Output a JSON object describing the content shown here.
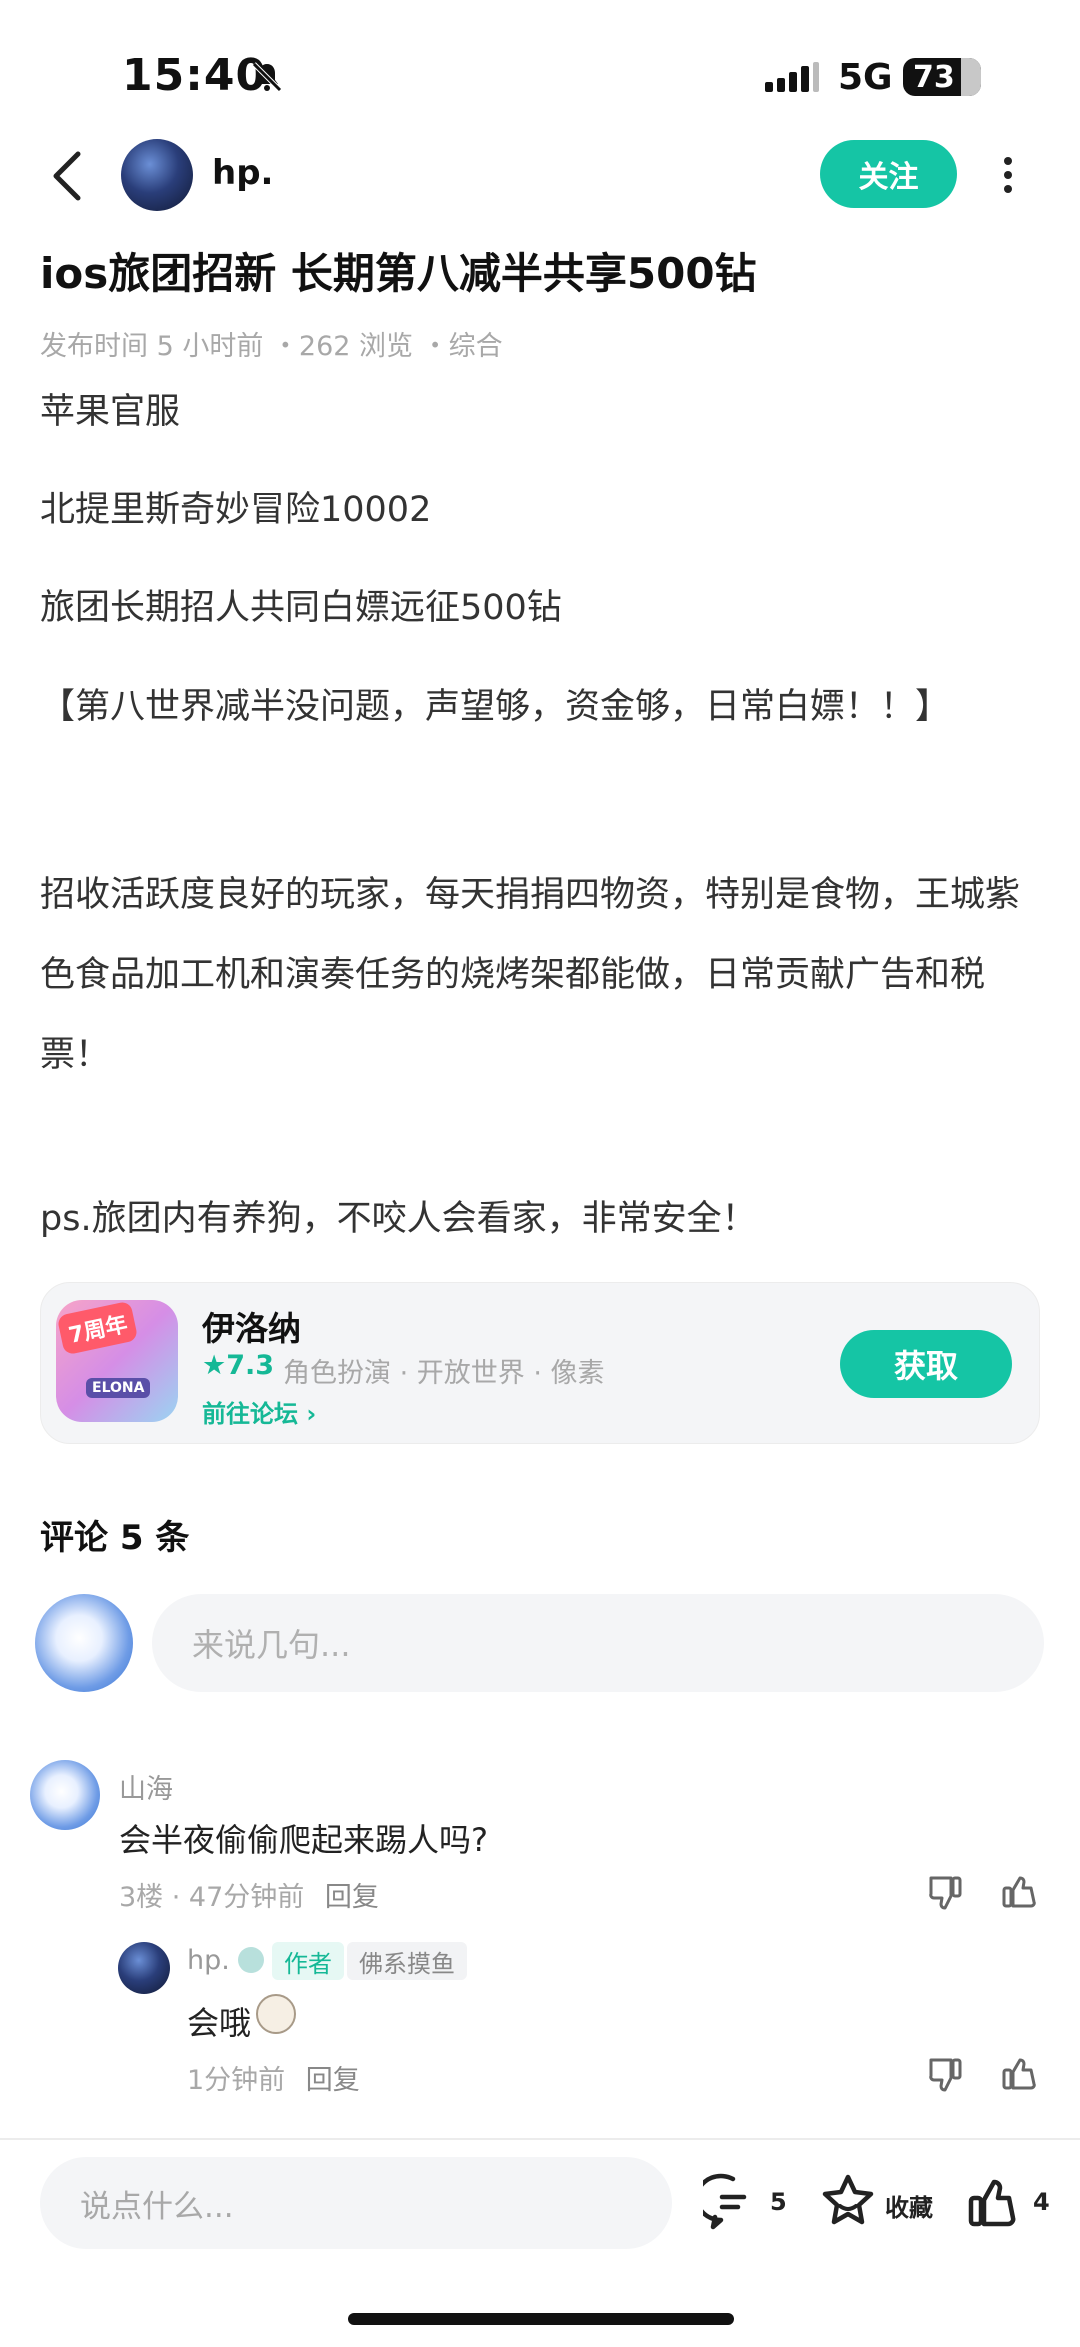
{
  "status_bar": {
    "time": "15:40",
    "network": "5G",
    "battery": "73"
  },
  "header": {
    "author": "hp.",
    "follow_label": "关注"
  },
  "post": {
    "title": "ios旅团招新 长期第八减半共享500钻",
    "meta": "发布时间 5 小时前 ・262 浏览 ・综合",
    "paragraphs": [
      "苹果官服",
      "北提里斯奇妙冒险10002",
      "旅团长期招人共同白嫖远征500钻",
      "【第八世界减半没问题，声望够，资金够，日常白嫖！！】",
      "招收活跃度良好的玩家，每天捐捐四物资，特别是食物，王城紫色食品加工机和演奏任务的烧烤架都能做，日常贡献广告和税票！",
      "ps.旅团内有养狗，不咬人会看家，非常安全！"
    ]
  },
  "game_card": {
    "icon_badge": "7周年",
    "icon_text": "ELONA",
    "name": "伊洛纳",
    "rating": "★7.3",
    "tags": "角色扮演 · 开放世界 · 像素",
    "forum_link": "前往论坛 ›",
    "get_label": "获取"
  },
  "comments": {
    "title": "评论 5 条",
    "input_placeholder": "来说几句...",
    "items": [
      {
        "user": "山海",
        "text": "会半夜偷偷爬起来踢人吗?",
        "meta": "3楼 · 47分钟前",
        "reply_label": "回复",
        "replies": [
          {
            "user": "hp.",
            "badge_author": "作者",
            "badge_title": "佛系摸鱼",
            "text": "会哦",
            "meta": "1分钟前",
            "reply_label": "回复"
          }
        ]
      }
    ]
  },
  "bottom_bar": {
    "input_placeholder": "说点什么...",
    "comment_count": "5",
    "favorite_label": "收藏",
    "like_count": "4"
  },
  "colors": {
    "accent": "#15c5a5",
    "muted": "#a8a8a8"
  }
}
